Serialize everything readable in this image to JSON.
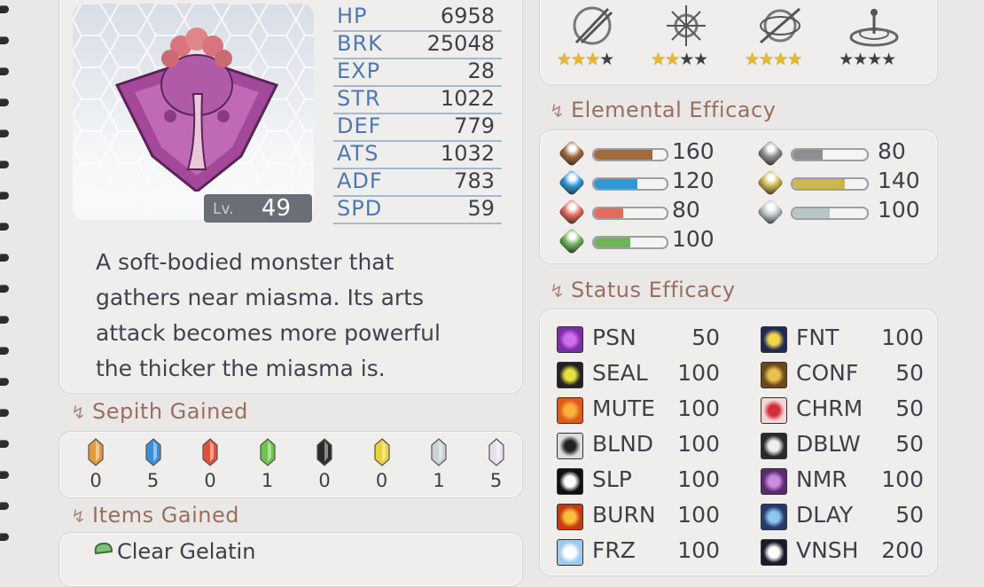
{
  "monster": {
    "level_label": "Lv.",
    "level": "49",
    "description_lines": [
      "A soft-bodied monster that",
      "gathers near miasma. Its arts",
      "attack becomes more powerful",
      "the thicker the miasma is."
    ]
  },
  "stats": [
    {
      "name": "HP",
      "value": "6958"
    },
    {
      "name": "BRK",
      "value": "25048"
    },
    {
      "name": "EXP",
      "value": "28"
    },
    {
      "name": "STR",
      "value": "1022"
    },
    {
      "name": "DEF",
      "value": "779"
    },
    {
      "name": "ATS",
      "value": "1032"
    },
    {
      "name": "ADF",
      "value": "783"
    },
    {
      "name": "SPD",
      "value": "59"
    }
  ],
  "resistances": [
    {
      "icon": "slash-resist-icon",
      "stars": 3,
      "max": 4
    },
    {
      "icon": "thrust-resist-icon",
      "stars": 2,
      "max": 4
    },
    {
      "icon": "pierce-resist-icon",
      "stars": 4,
      "max": 4
    },
    {
      "icon": "strike-resist-icon",
      "stars": 0,
      "max": 4
    }
  ],
  "sections": {
    "elemental": "Elemental Efficacy",
    "status": "Status Efficacy",
    "sepith": "Sepith Gained",
    "items": "Items Gained"
  },
  "elemental": [
    {
      "icon": "earth-gem-icon",
      "value": "160",
      "level": 0.8,
      "color": "#a06a3c"
    },
    {
      "icon": "water-gem-icon",
      "value": "120",
      "level": 0.6,
      "color": "#2f98d6"
    },
    {
      "icon": "fire-gem-icon",
      "value": "80",
      "level": 0.4,
      "color": "#e26b5e"
    },
    {
      "icon": "wind-gem-icon",
      "value": "100",
      "level": 0.5,
      "color": "#6fb25a"
    },
    {
      "icon": "time-gem-icon",
      "value": "80",
      "level": 0.4,
      "color": "#8e8e92"
    },
    {
      "icon": "space-gem-icon",
      "value": "140",
      "level": 0.7,
      "color": "#cdb64e"
    },
    {
      "icon": "mirage-gem-icon",
      "value": "100",
      "level": 0.5,
      "color": "#b9c6c8"
    }
  ],
  "status": [
    {
      "icon": "poison-icon",
      "name": "PSN",
      "value": "50"
    },
    {
      "icon": "seal-icon",
      "name": "SEAL",
      "value": "100"
    },
    {
      "icon": "mute-icon",
      "name": "MUTE",
      "value": "100"
    },
    {
      "icon": "blind-icon",
      "name": "BLND",
      "value": "100"
    },
    {
      "icon": "sleep-icon",
      "name": "SLP",
      "value": "100"
    },
    {
      "icon": "burn-icon",
      "name": "BURN",
      "value": "100"
    },
    {
      "icon": "freeze-icon",
      "name": "FRZ",
      "value": "100"
    },
    {
      "icon": "faint-icon",
      "name": "FNT",
      "value": "100"
    },
    {
      "icon": "confuse-icon",
      "name": "CONF",
      "value": "50"
    },
    {
      "icon": "charm-icon",
      "name": "CHRM",
      "value": "50"
    },
    {
      "icon": "deathblow-icon",
      "name": "DBLW",
      "value": "50"
    },
    {
      "icon": "nightmare-icon",
      "name": "NMR",
      "value": "100"
    },
    {
      "icon": "delay-icon",
      "name": "DLAY",
      "value": "50"
    },
    {
      "icon": "vanish-icon",
      "name": "VNSH",
      "value": "200"
    }
  ],
  "sepith": [
    {
      "icon": "earth-sepith-icon",
      "count": "0",
      "color": "#e39a3a"
    },
    {
      "icon": "water-sepith-icon",
      "count": "5",
      "color": "#3a8fd8"
    },
    {
      "icon": "fire-sepith-icon",
      "count": "0",
      "color": "#e2503a"
    },
    {
      "icon": "wind-sepith-icon",
      "count": "1",
      "color": "#6fc24a"
    },
    {
      "icon": "time-sepith-icon",
      "count": "0",
      "color": "#2b2b2e"
    },
    {
      "icon": "space-sepith-icon",
      "count": "0",
      "color": "#e8d43a"
    },
    {
      "icon": "mirage-sepith-icon",
      "count": "1",
      "color": "#c9d2d6"
    },
    {
      "icon": "mass-sepith-icon",
      "count": "5",
      "color": "#e6e0ee"
    }
  ],
  "items": [
    {
      "icon": "gelatin-icon",
      "label": "Clear Gelatin"
    }
  ]
}
